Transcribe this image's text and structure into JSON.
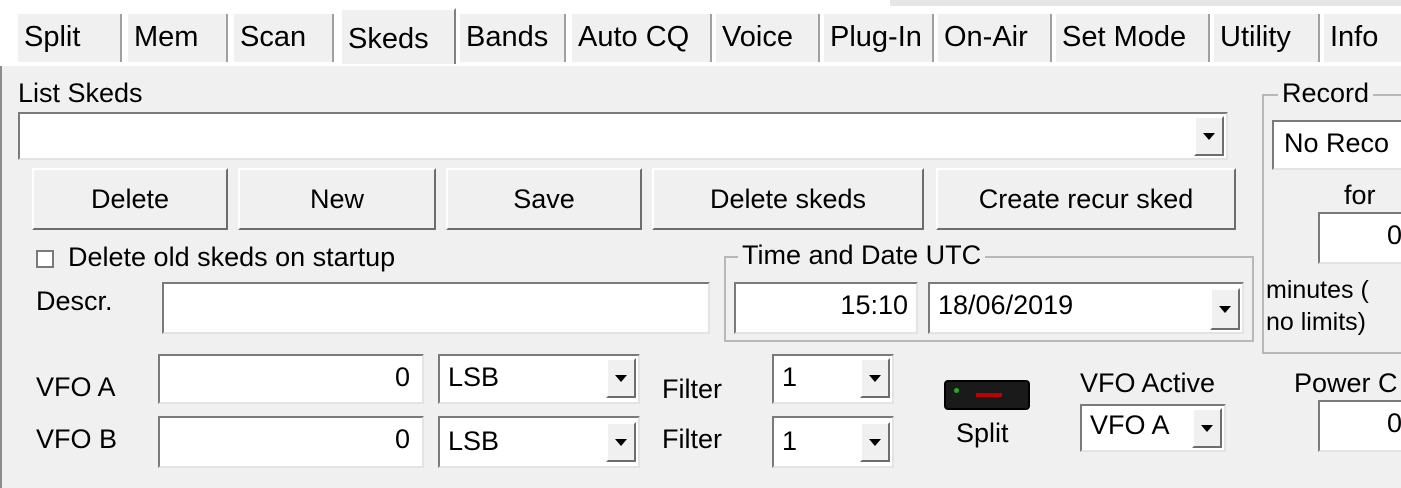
{
  "tabs": [
    {
      "label": "Split"
    },
    {
      "label": "Mem"
    },
    {
      "label": "Scan"
    },
    {
      "label": "Skeds"
    },
    {
      "label": "Bands"
    },
    {
      "label": "Auto CQ"
    },
    {
      "label": "Voice"
    },
    {
      "label": "Plug-In"
    },
    {
      "label": "On-Air"
    },
    {
      "label": "Set Mode"
    },
    {
      "label": "Utility"
    },
    {
      "label": "Info"
    }
  ],
  "active_tab": "Skeds",
  "list_skeds": {
    "label": "List Skeds",
    "value": ""
  },
  "buttons": {
    "delete": "Delete",
    "new": "New",
    "save": "Save",
    "delete_skeds": "Delete skeds",
    "create_recur": "Create recur sked"
  },
  "delete_old": {
    "label": "Delete old skeds on startup",
    "checked": false
  },
  "descr": {
    "label": "Descr.",
    "value": ""
  },
  "time_date": {
    "title": "Time and Date UTC",
    "time": "15:10",
    "date": "18/06/2019"
  },
  "vfo_a": {
    "label": "VFO A",
    "freq": "0",
    "mode": "LSB",
    "filter_label": "Filter",
    "filter": "1"
  },
  "vfo_b": {
    "label": "VFO B",
    "freq": "0",
    "mode": "LSB",
    "filter_label": "Filter",
    "filter": "1"
  },
  "split": {
    "label": "Split"
  },
  "vfo_active": {
    "label": "VFO Active",
    "value": "VFO A"
  },
  "record": {
    "title": "Record",
    "value": "No Reco",
    "for_label": "for",
    "minutes": "0",
    "minutes_label_1": "minutes (",
    "minutes_label_2": "no limits)"
  },
  "power": {
    "label": "Power C",
    "value": "0"
  },
  "colors": {
    "panel_bg": "#f0f0f0",
    "led_red": "#c00000",
    "led_green": "#22aa22"
  }
}
